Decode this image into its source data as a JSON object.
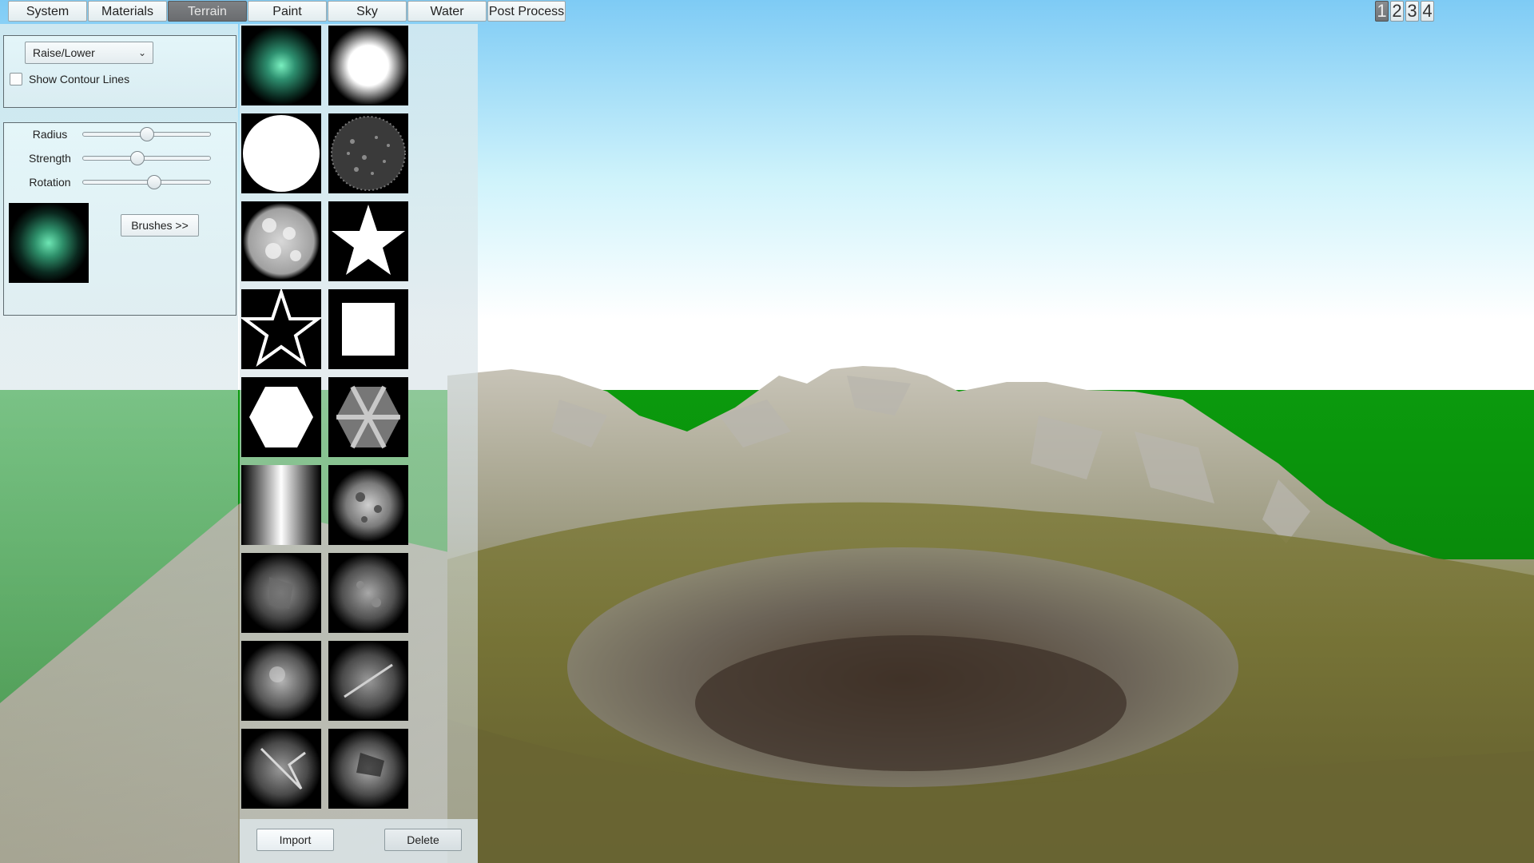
{
  "tabs": [
    {
      "label": "System",
      "active": false
    },
    {
      "label": "Materials",
      "active": false
    },
    {
      "label": "Terrain",
      "active": true
    },
    {
      "label": "Paint",
      "active": false
    },
    {
      "label": "Sky",
      "active": false
    },
    {
      "label": "Water",
      "active": false
    },
    {
      "label": "Post Process",
      "active": false
    }
  ],
  "view_numbers": [
    {
      "label": "1",
      "active": true
    },
    {
      "label": "2",
      "active": false
    },
    {
      "label": "3",
      "active": false
    },
    {
      "label": "4",
      "active": false
    }
  ],
  "tool": {
    "selected": "Raise/Lower",
    "show_contour_label": "Show Contour Lines",
    "show_contour_checked": false
  },
  "brush_settings": {
    "sliders": [
      {
        "label": "Radius",
        "value": 0.5
      },
      {
        "label": "Strength",
        "value": 0.43
      },
      {
        "label": "Rotation",
        "value": 0.56
      }
    ],
    "brushes_button": "Brushes >>"
  },
  "brush_library": {
    "brushes": [
      "soft-green-glow",
      "soft-white-circle",
      "hard-white-circle",
      "noise-circle",
      "cloud-circle",
      "solid-star",
      "star-outline",
      "square",
      "hexagon",
      "hexagon-star",
      "vertical-gradient",
      "rock-noise-1",
      "rock-noise-2",
      "rock-noise-3",
      "rock-noise-4",
      "rock-streak",
      "rock-crack",
      "rock-noise-5"
    ],
    "import_label": "Import",
    "delete_label": "Delete"
  },
  "colors": {
    "sky_top": "#86d0f4",
    "sky_bottom": "#ffffff",
    "ground_green": "#078a0a",
    "accent_active_tab": "#747779"
  }
}
